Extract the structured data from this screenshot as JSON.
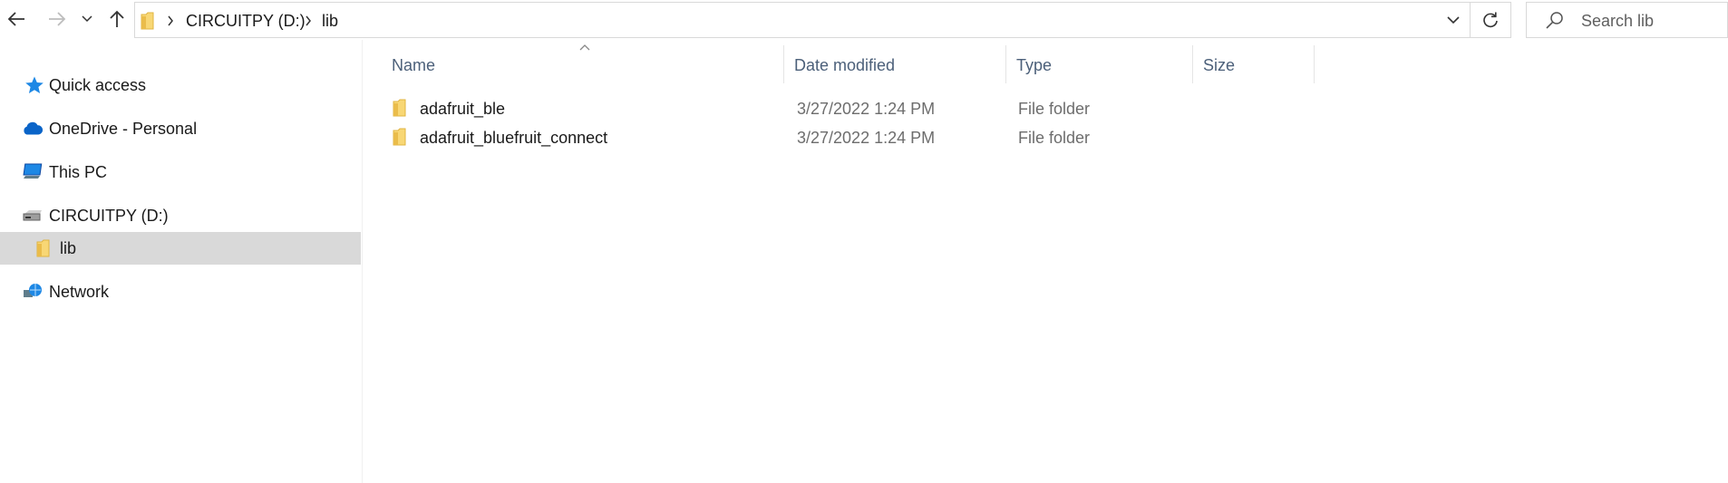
{
  "addressbar": {
    "crumbs": [
      "CIRCUITPY (D:)",
      "lib"
    ]
  },
  "search": {
    "placeholder": "Search lib"
  },
  "navpane": {
    "items": [
      {
        "label": "Quick access",
        "icon": "star-icon"
      },
      {
        "label": "OneDrive - Personal",
        "icon": "cloud-icon"
      },
      {
        "label": "This PC",
        "icon": "computer-icon"
      },
      {
        "label": "CIRCUITPY (D:)",
        "icon": "drive-icon"
      },
      {
        "label": "lib",
        "icon": "folder-icon",
        "selected": true
      },
      {
        "label": "Network",
        "icon": "network-icon"
      }
    ]
  },
  "columns": {
    "name": "Name",
    "date_modified": "Date modified",
    "type": "Type",
    "size": "Size"
  },
  "files": [
    {
      "name": "adafruit_ble",
      "date_modified": "3/27/2022 1:24 PM",
      "type": "File folder",
      "size": ""
    },
    {
      "name": "adafruit_bluefruit_connect",
      "date_modified": "3/27/2022 1:24 PM",
      "type": "File folder",
      "size": ""
    }
  ],
  "colors": {
    "folder": "#f8d775",
    "selected_bg": "#d9d9d9",
    "header_text": "#4c607a",
    "accent": "#0078d4"
  }
}
